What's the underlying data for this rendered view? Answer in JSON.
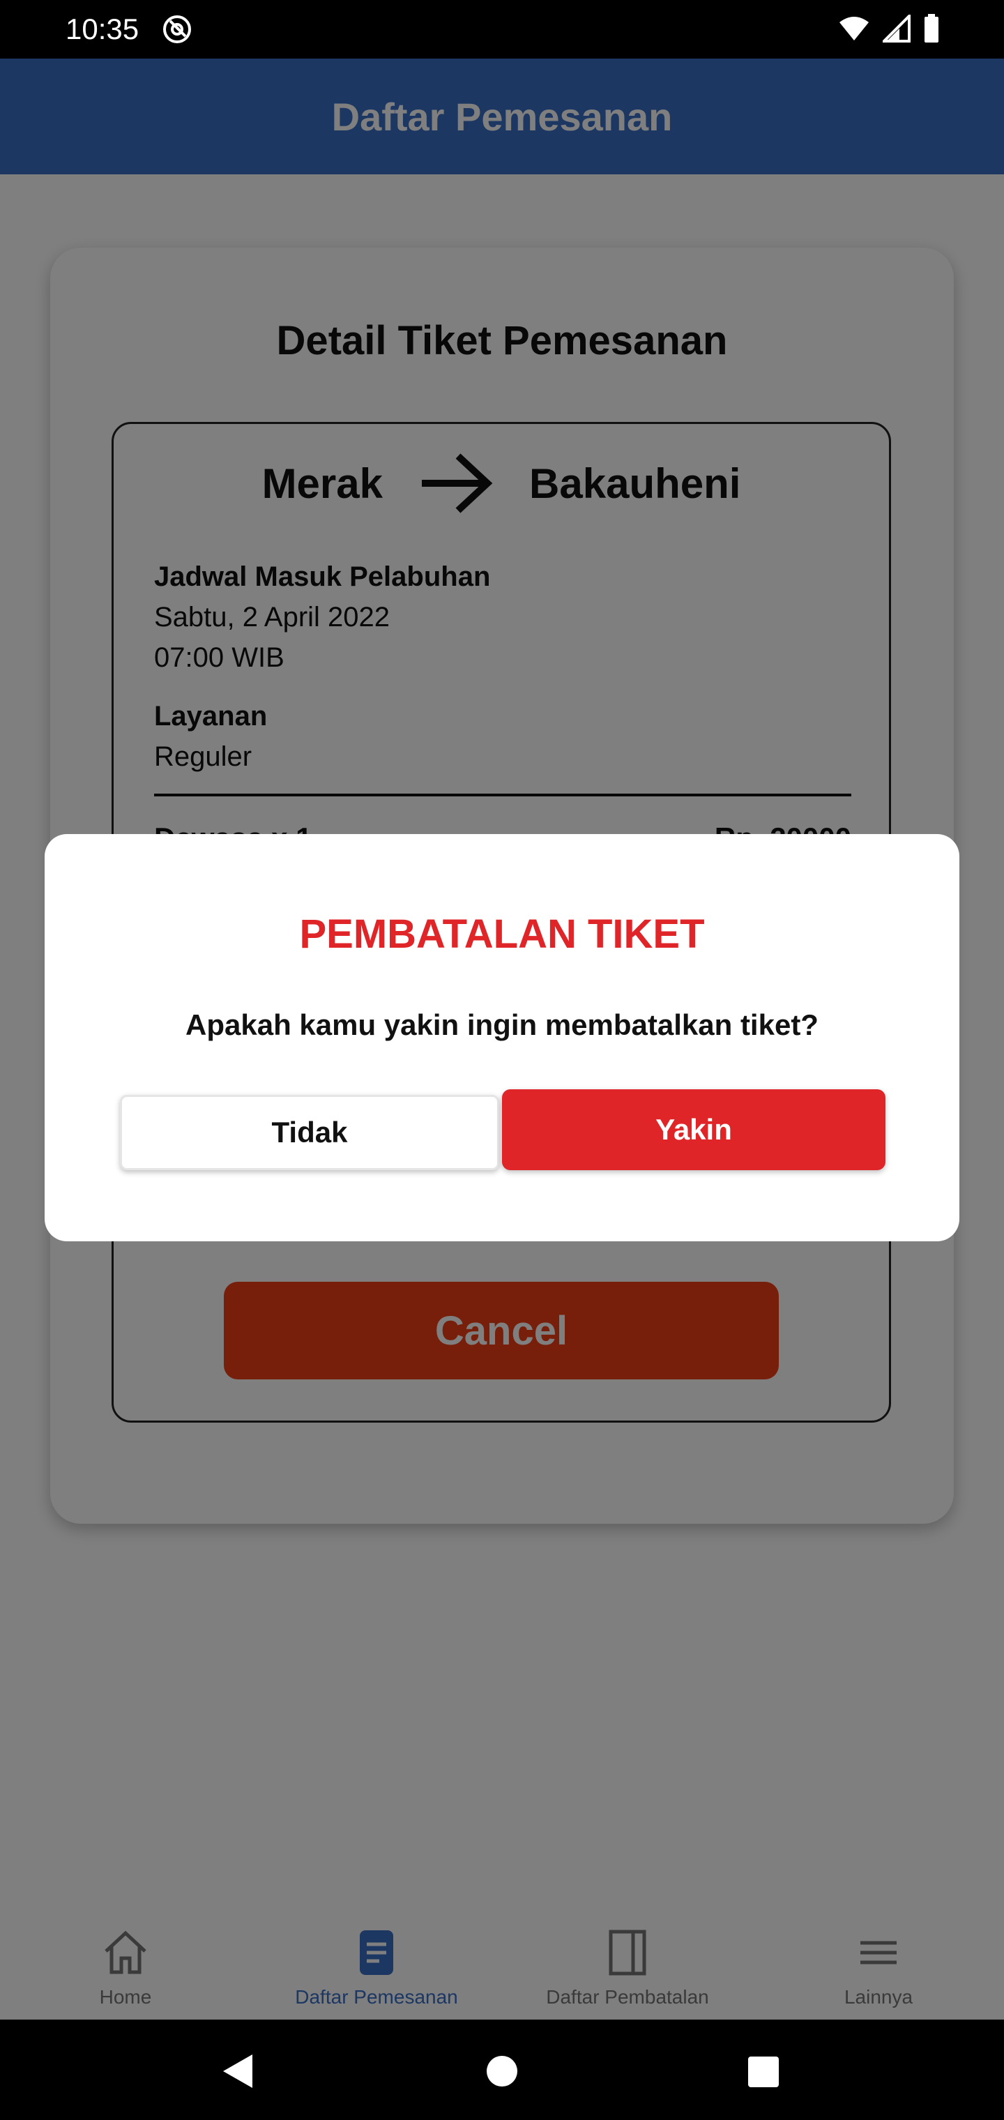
{
  "status_bar": {
    "time": "10:35"
  },
  "app_bar": {
    "title": "Daftar Pemesanan"
  },
  "detail": {
    "card_title": "Detail Tiket Pemesanan",
    "origin": "Merak",
    "destination": "Bakauheni",
    "schedule_label": "Jadwal Masuk Pelabuhan",
    "schedule_date": "Sabtu, 2 April 2022",
    "schedule_time": "07:00 WIB",
    "service_label": "Layanan",
    "service_value": "Reguler",
    "passenger_label": "Dewasa x 1",
    "passenger_price": "Rp. 20000",
    "cancel_label": "Cancel"
  },
  "dialog": {
    "title": "PEMBATALAN TIKET",
    "message": "Apakah kamu yakin ingin membatalkan tiket?",
    "no_label": "Tidak",
    "yes_label": "Yakin"
  },
  "bottom_nav": {
    "items": [
      {
        "label": "Home",
        "icon": "home-icon",
        "active": false
      },
      {
        "label": "Daftar Pemesanan",
        "icon": "document-icon",
        "active": true
      },
      {
        "label": "Daftar Pembatalan",
        "icon": "book-icon",
        "active": false
      },
      {
        "label": "Lainnya",
        "icon": "menu-icon",
        "active": false
      }
    ]
  },
  "colors": {
    "app_bar": "#3a6ec6",
    "cancel_button": "#f13f17",
    "dialog_accent": "#e02528",
    "nav_active": "#3a6ec6",
    "nav_inactive": "#757575"
  }
}
